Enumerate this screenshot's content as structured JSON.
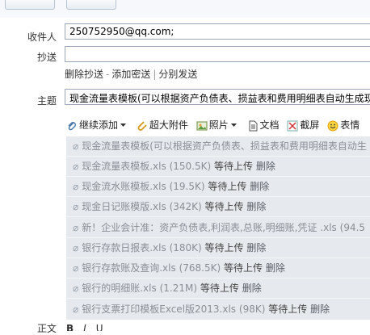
{
  "compose": {
    "recipient_label": "收件人",
    "recipient_value": "250752950@qq.com;",
    "cc_label": "抄送",
    "cc_value": "",
    "links": [
      "删除抄送",
      "添加密送",
      "分别发送"
    ],
    "subject_label": "主题",
    "subject_value": "现金流量表模板(可以根据资产负债表、损益表和费用明细表自动生成现"
  },
  "toolbar": {
    "continue_add": "继续添加",
    "super_attach": "超大附件",
    "photo": "照片",
    "document": "文档",
    "screenshot": "截屏",
    "emoji": "表情"
  },
  "attachments": [
    {
      "name": "现金流量表模板(可以根据资产负债表、损益表和费用明细表自动生",
      "size": "",
      "status": "",
      "action": ""
    },
    {
      "name": "现金流量表模板.xls",
      "size": "(150.5K)",
      "status": "等待上传",
      "action": "删除"
    },
    {
      "name": "现金流水账模板.xls",
      "size": "(19.5K)",
      "status": "等待上传",
      "action": "删除"
    },
    {
      "name": "现金日记账模版.xls",
      "size": "(342K)",
      "status": "等待上传",
      "action": "删除"
    },
    {
      "name": "新！企业会计准：资产负债表,利润表,总账,明细账,凭证 .xls",
      "size": "(94.5",
      "status": "",
      "action": ""
    },
    {
      "name": "银行存款日报表.xls",
      "size": "(180K)",
      "status": "等待上传",
      "action": "删除"
    },
    {
      "name": "银行存款账及查询.xls",
      "size": "(768.5K)",
      "status": "等待上传",
      "action": "删除"
    },
    {
      "name": "银行的明细账.xls",
      "size": "(1.21M)",
      "status": "等待上传",
      "action": "删除"
    },
    {
      "name": "银行支票打印模板Excel版2013.xls",
      "size": "(98K)",
      "status": "等待上传",
      "action": "删除"
    }
  ],
  "body_label": "正文",
  "format_bar": [
    "B",
    "I",
    "U"
  ],
  "colors": {
    "attach_bg": "#e6e9ed",
    "field_border": "#9aa7b8"
  }
}
